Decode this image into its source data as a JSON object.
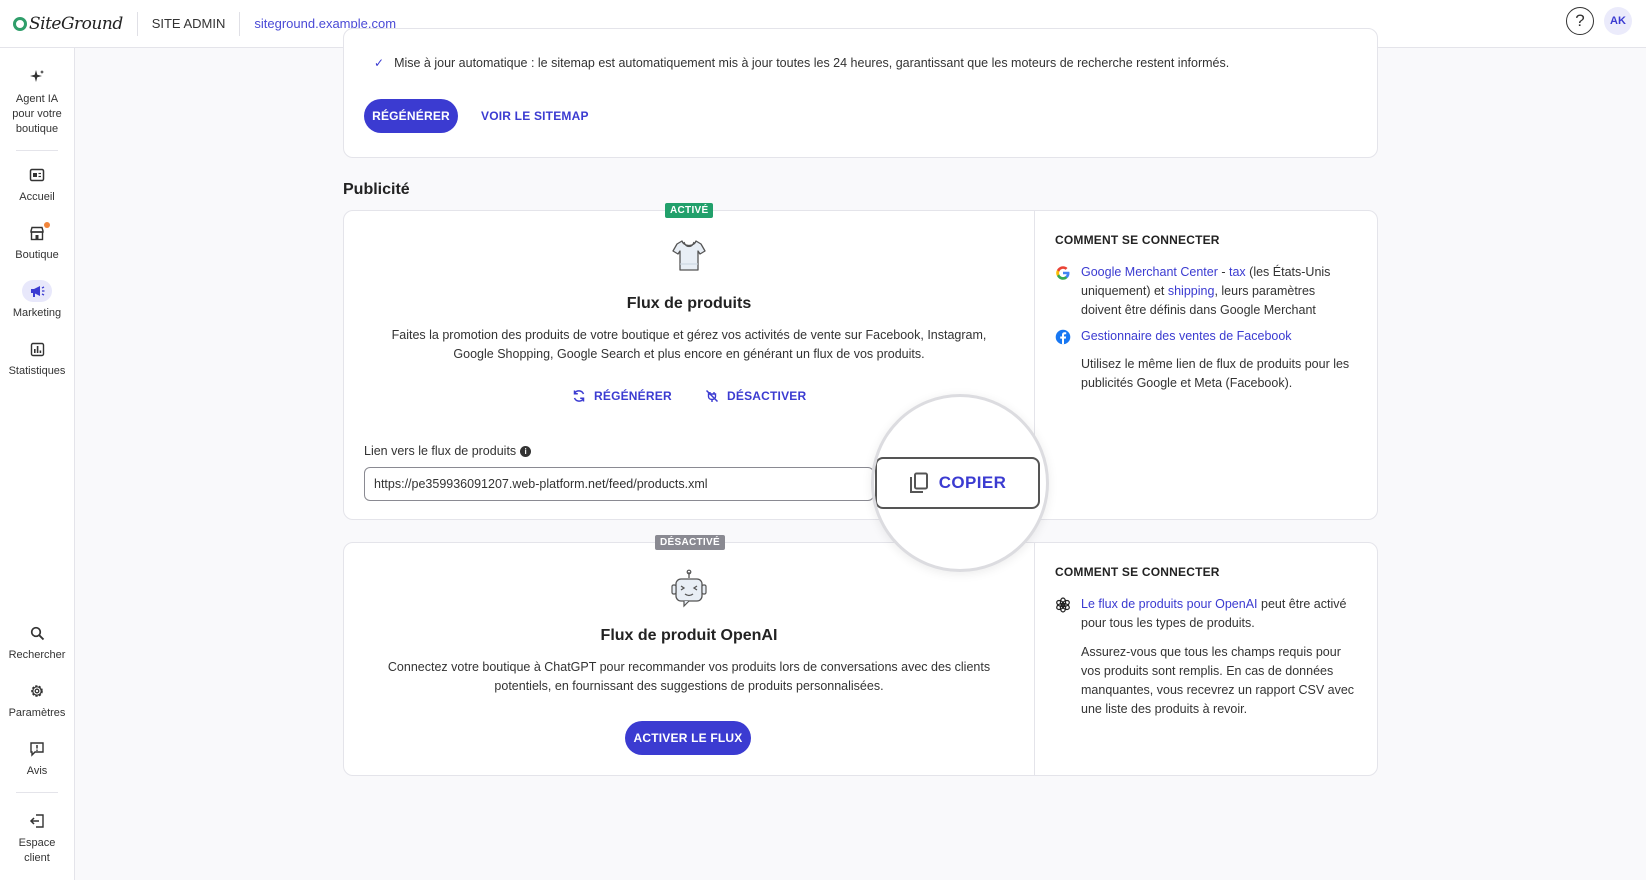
{
  "topbar": {
    "logo_text": "SiteGround",
    "site_admin": "SITE ADMIN",
    "site_url": "siteground.example.com",
    "help_icon": "?",
    "avatar": "AK"
  },
  "sidebar": {
    "items": [
      {
        "label": "Agent IA pour votre boutique",
        "icon": "sparkle-icon"
      },
      {
        "label": "Accueil",
        "icon": "home-icon"
      },
      {
        "label": "Boutique",
        "icon": "store-icon"
      },
      {
        "label": "Marketing",
        "icon": "megaphone-icon"
      },
      {
        "label": "Statistiques",
        "icon": "chart-icon"
      },
      {
        "label": "Rechercher",
        "icon": "search-icon"
      },
      {
        "label": "Paramètres",
        "icon": "gear-icon"
      },
      {
        "label": "Avis",
        "icon": "feedback-icon"
      },
      {
        "label": "Espace client",
        "icon": "exit-icon"
      }
    ]
  },
  "sitemap": {
    "check_text": "Mise à jour automatique : le sitemap est automatiquement mis à jour toutes les 24 heures, garantissant que les moteurs de recherche restent informés.",
    "regen_label": "RÉGÉNÉRER",
    "view_label": "VOIR LE SITEMAP"
  },
  "publicite": {
    "section_title": "Publicité",
    "products_feed": {
      "badge": "ACTIVÉ",
      "title": "Flux de produits",
      "description": "Faites la promotion des produits de votre boutique et gérez vos activités de vente sur Facebook, Instagram, Google Shopping, Google Search et plus encore en générant un flux de vos produits.",
      "regen_label": "RÉGÉNÉRER",
      "disable_label": "DÉSACTIVER",
      "field_label": "Lien vers le flux de produits",
      "url": "https://pe359936091207.web-platform.net/feed/products.xml",
      "copy_label": "COPIER",
      "howto_title": "COMMENT SE CONNECTER",
      "google_link1": "Google Merchant Center",
      "google_sep": " - ",
      "google_link2": "tax",
      "google_text1": " (les États-Unis uniquement) et ",
      "google_link3": "shipping",
      "google_text2": ", leurs paramètres doivent être définis dans Google Merchant",
      "facebook_link": "Gestionnaire des ventes de Facebook",
      "note": "Utilisez le même lien de flux de produits pour les publicités Google et Meta (Facebook)."
    },
    "openai_feed": {
      "badge": "DÉSACTIVÉ",
      "title": "Flux de produit OpenAI",
      "description": "Connectez votre boutique à ChatGPT pour recommander vos produits lors de conversations avec des clients potentiels, en fournissant des suggestions de produits personnalisées.",
      "activate_label": "ACTIVER LE FLUX",
      "howto_title": "COMMENT SE CONNECTER",
      "openai_link": "Le flux de produits pour OpenAI",
      "openai_text": " peut être activé pour tous les types de produits.",
      "note": "Assurez-vous que tous les champs requis pour vos produits sont remplis. En cas de données manquantes, vous recevrez un rapport CSV avec une liste des produits à revoir."
    }
  },
  "colors": {
    "accent": "#3b3bd1",
    "active_badge": "#22a06b",
    "inactive_badge": "#8a8a92"
  }
}
